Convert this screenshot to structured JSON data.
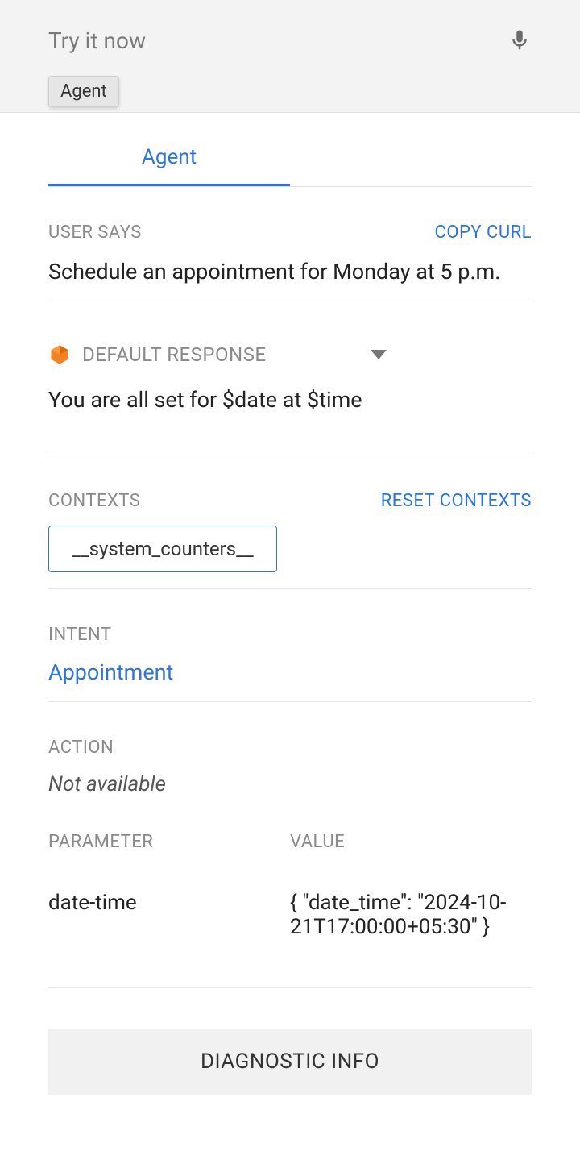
{
  "header": {
    "placeholder": "Try it now",
    "chip": "Agent"
  },
  "tabs": {
    "agent": "Agent"
  },
  "userSays": {
    "label": "USER SAYS",
    "copy": "COPY CURL",
    "text": "Schedule an appointment for Monday at 5 p.m."
  },
  "response": {
    "label": "DEFAULT RESPONSE",
    "text": "You are all set for $date at $time"
  },
  "contexts": {
    "label": "CONTEXTS",
    "reset": "RESET CONTEXTS",
    "chip": "__system_counters__"
  },
  "intent": {
    "label": "INTENT",
    "value": "Appointment"
  },
  "action": {
    "label": "ACTION",
    "value": "Not available"
  },
  "params": {
    "headerParam": "PARAMETER",
    "headerValue": "VALUE",
    "rows": [
      {
        "name": "date-time",
        "value": "{ \"date_time\": \"2024-10-21T17:00:00+05:30\" }"
      }
    ]
  },
  "diagnostic": "DIAGNOSTIC INFO"
}
